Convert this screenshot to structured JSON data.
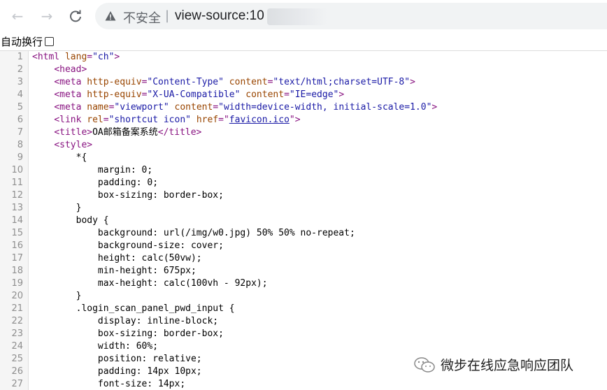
{
  "browser": {
    "back_icon": "arrow-left-icon",
    "forward_icon": "arrow-right-icon",
    "reload_icon": "reload-icon",
    "security_icon": "warning-triangle-icon",
    "security_text": "不安全",
    "separator": "|",
    "url": "view-source:10"
  },
  "wrap_toggle": {
    "label": "自动换行",
    "checked": false
  },
  "source": {
    "lines": [
      {
        "n": "1",
        "indent": "",
        "segs": [
          [
            "tag",
            "<html "
          ],
          [
            "attr",
            "lang"
          ],
          [
            "tag",
            "="
          ],
          [
            "val",
            "\"ch\""
          ],
          [
            "tag",
            ">"
          ]
        ]
      },
      {
        "n": "2",
        "indent": "    ",
        "segs": [
          [
            "tag",
            "<head>"
          ]
        ]
      },
      {
        "n": "3",
        "indent": "    ",
        "segs": [
          [
            "tag",
            "<meta "
          ],
          [
            "attr",
            "http-equiv"
          ],
          [
            "tag",
            "="
          ],
          [
            "val",
            "\"Content-Type\""
          ],
          [
            "tag",
            " "
          ],
          [
            "attr",
            "content"
          ],
          [
            "tag",
            "="
          ],
          [
            "val",
            "\"text/html;charset=UTF-8\""
          ],
          [
            "tag",
            ">"
          ]
        ]
      },
      {
        "n": "4",
        "indent": "    ",
        "segs": [
          [
            "tag",
            "<meta "
          ],
          [
            "attr",
            "http-equiv"
          ],
          [
            "tag",
            "="
          ],
          [
            "val",
            "\"X-UA-Compatible\""
          ],
          [
            "tag",
            " "
          ],
          [
            "attr",
            "content"
          ],
          [
            "tag",
            "="
          ],
          [
            "val",
            "\"IE=edge\""
          ],
          [
            "tag",
            ">"
          ]
        ]
      },
      {
        "n": "5",
        "indent": "    ",
        "segs": [
          [
            "tag",
            "<meta "
          ],
          [
            "attr",
            "name"
          ],
          [
            "tag",
            "="
          ],
          [
            "val",
            "\"viewport\""
          ],
          [
            "tag",
            " "
          ],
          [
            "attr",
            "content"
          ],
          [
            "tag",
            "="
          ],
          [
            "val",
            "\"width=device-width, initial-scale=1.0\""
          ],
          [
            "tag",
            ">"
          ]
        ]
      },
      {
        "n": "6",
        "indent": "    ",
        "segs": [
          [
            "tag",
            "<link "
          ],
          [
            "attr",
            "rel"
          ],
          [
            "tag",
            "="
          ],
          [
            "val",
            "\"shortcut icon\""
          ],
          [
            "tag",
            " "
          ],
          [
            "attr",
            "href"
          ],
          [
            "tag",
            "=\""
          ],
          [
            "link",
            "favicon.ico"
          ],
          [
            "tag",
            "\">"
          ]
        ]
      },
      {
        "n": "7",
        "indent": "    ",
        "segs": [
          [
            "tag",
            "<title>"
          ],
          [
            "css",
            "OA邮箱备案系统"
          ],
          [
            "tag",
            "</title>"
          ]
        ]
      },
      {
        "n": "8",
        "indent": "    ",
        "segs": [
          [
            "tag",
            "<style>"
          ]
        ]
      },
      {
        "n": "9",
        "indent": "        ",
        "segs": [
          [
            "css",
            "*{"
          ]
        ]
      },
      {
        "n": "10",
        "indent": "            ",
        "segs": [
          [
            "css",
            "margin: 0;"
          ]
        ]
      },
      {
        "n": "11",
        "indent": "            ",
        "segs": [
          [
            "css",
            "padding: 0;"
          ]
        ]
      },
      {
        "n": "12",
        "indent": "            ",
        "segs": [
          [
            "css",
            "box-sizing: border-box;"
          ]
        ]
      },
      {
        "n": "13",
        "indent": "        ",
        "segs": [
          [
            "css",
            "}"
          ]
        ]
      },
      {
        "n": "14",
        "indent": "        ",
        "segs": [
          [
            "css",
            "body {"
          ]
        ]
      },
      {
        "n": "15",
        "indent": "            ",
        "segs": [
          [
            "css",
            "background: url(/img/w0.jpg) 50% 50% no-repeat;"
          ]
        ]
      },
      {
        "n": "16",
        "indent": "            ",
        "segs": [
          [
            "css",
            "background-size: cover;"
          ]
        ]
      },
      {
        "n": "17",
        "indent": "            ",
        "segs": [
          [
            "css",
            "height: calc(50vw);"
          ]
        ]
      },
      {
        "n": "18",
        "indent": "            ",
        "segs": [
          [
            "css",
            "min-height: 675px;"
          ]
        ]
      },
      {
        "n": "19",
        "indent": "            ",
        "segs": [
          [
            "css",
            "max-height: calc(100vh - 92px);"
          ]
        ]
      },
      {
        "n": "20",
        "indent": "        ",
        "segs": [
          [
            "css",
            "}"
          ]
        ]
      },
      {
        "n": "21",
        "indent": "        ",
        "segs": [
          [
            "css",
            ".login_scan_panel_pwd_input {"
          ]
        ]
      },
      {
        "n": "22",
        "indent": "            ",
        "segs": [
          [
            "css",
            "display: inline-block;"
          ]
        ]
      },
      {
        "n": "23",
        "indent": "            ",
        "segs": [
          [
            "css",
            "box-sizing: border-box;"
          ]
        ]
      },
      {
        "n": "24",
        "indent": "            ",
        "segs": [
          [
            "css",
            "width: 60%;"
          ]
        ]
      },
      {
        "n": "25",
        "indent": "            ",
        "segs": [
          [
            "css",
            "position: relative;"
          ]
        ]
      },
      {
        "n": "26",
        "indent": "            ",
        "segs": [
          [
            "css",
            "padding: 14px 10px;"
          ]
        ]
      },
      {
        "n": "27",
        "indent": "            ",
        "segs": [
          [
            "css",
            "font-size: 14px;"
          ]
        ]
      }
    ]
  },
  "watermark": {
    "icon": "wechat-icon",
    "text": "微步在线应急响应团队"
  }
}
